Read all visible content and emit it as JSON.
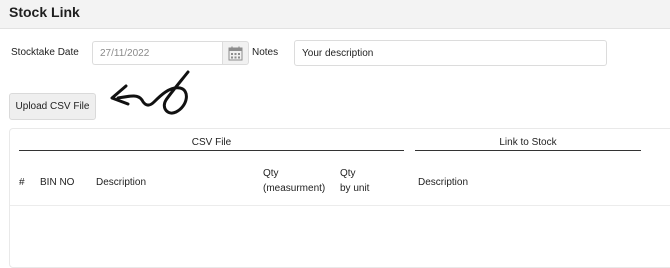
{
  "header": {
    "title": "Stock Link"
  },
  "form": {
    "stocktake_label": "Stocktake Date",
    "date_value": "27/11/2022",
    "notes_label": "Notes",
    "notes_value": "Your description"
  },
  "upload": {
    "label": "Upload CSV File"
  },
  "table": {
    "groups": [
      "CSV File",
      "Link to Stock"
    ],
    "columns": {
      "index": "#",
      "bin_no": "BIN NO",
      "description": "Description",
      "qty_measurement": [
        "Qty",
        "(measurment)"
      ],
      "qty_unit": [
        "Qty",
        "by unit"
      ],
      "link_description": "Description"
    }
  },
  "icons": {
    "calendar": "calendar-icon",
    "annotation": "hand-drawn-arrow"
  }
}
